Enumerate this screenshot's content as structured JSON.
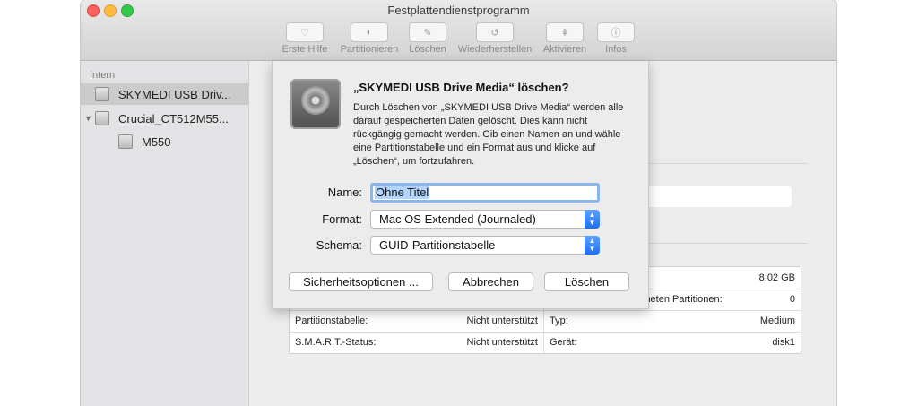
{
  "window": {
    "title": "Festplattendienstprogramm",
    "toolbar": [
      {
        "label": "Erste Hilfe",
        "icon": "stethoscope-icon",
        "glyph": "♡"
      },
      {
        "label": "Partitionieren",
        "icon": "partition-icon",
        "glyph": "◐"
      },
      {
        "label": "Löschen",
        "icon": "erase-icon",
        "glyph": "✎"
      },
      {
        "label": "Wiederherstellen",
        "icon": "restore-icon",
        "glyph": "↺"
      },
      {
        "label": "Aktivieren",
        "icon": "mount-icon",
        "glyph": "⇞"
      },
      {
        "label": "Infos",
        "icon": "info-icon",
        "glyph": "ⓘ"
      }
    ]
  },
  "sidebar": {
    "section": "Intern",
    "items": [
      {
        "label": "SKYMEDI USB Driv..."
      },
      {
        "label": "Crucial_CT512M55..."
      },
      {
        "label": "M550"
      }
    ]
  },
  "sheet": {
    "title": "„SKYMEDI USB Drive Media“ löschen?",
    "description": "Durch Löschen von „SKYMEDI USB Drive Media“ werden alle darauf gespeicherten Daten gelöscht. Dies kann nicht rückgängig gemacht werden. Gib einen Namen an und wähle eine Partitionstabelle und ein Format aus und klicke auf „Löschen“, um fortzufahren.",
    "name_label": "Name:",
    "name_value": "Ohne Titel",
    "format_label": "Format:",
    "format_value": "Mac OS Extended (Journaled)",
    "schema_label": "Schema:",
    "schema_value": "GUID-Partitionstabelle",
    "btn_security": "Sicherheitsoptionen ...",
    "btn_cancel": "Abbrechen",
    "btn_erase": "Löschen"
  },
  "info": {
    "capacity_value": "8,02 GB",
    "partitions_label": "ineten Partitionen:",
    "partitions_value": "0",
    "partition_table_label": "Partitionstabelle:",
    "partition_table_value": "Nicht unterstützt",
    "type_label": "Typ:",
    "type_value": "Medium",
    "smart_label": "S.M.A.R.T.-Status:",
    "smart_value": "Nicht unterstützt",
    "device_label": "Gerät:",
    "device_value": "disk1"
  }
}
